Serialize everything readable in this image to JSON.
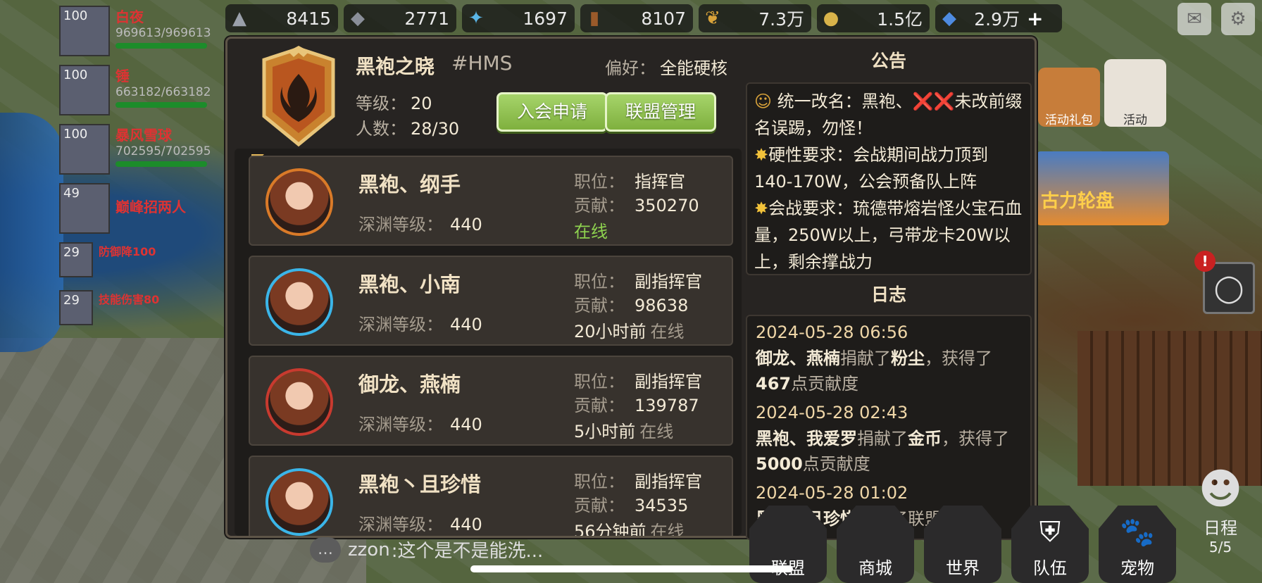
{
  "resources": [
    {
      "icon": "stone-icon",
      "value": "8415"
    },
    {
      "icon": "iron-icon",
      "value": "2771"
    },
    {
      "icon": "crystal-icon",
      "value": "1697"
    },
    {
      "icon": "wood-icon",
      "value": "8107"
    },
    {
      "icon": "wheat-icon",
      "value": "7.3万"
    },
    {
      "icon": "coin-icon",
      "value": "1.5亿"
    },
    {
      "icon": "diamond-icon",
      "value": "2.9万"
    }
  ],
  "party": [
    {
      "level": "100",
      "name": "白夜",
      "hp": "969613/969613"
    },
    {
      "level": "100",
      "name": "锤",
      "hp": "663182/663182"
    },
    {
      "level": "100",
      "name": "暴风雪球",
      "hp": "702595/702595"
    },
    {
      "level": "49",
      "name": "巅峰招两人",
      "hp": ""
    },
    {
      "level": "29",
      "name": "防御降100",
      "hp": ""
    },
    {
      "level": "29",
      "name": "技能伤害80",
      "hp": ""
    }
  ],
  "side": {
    "gift_label": "活动礼包",
    "event_label": "活动",
    "banner_label": "古力轮盘",
    "alert": "!"
  },
  "guild": {
    "name": "黑袍之晓",
    "tag": "#HMS",
    "pref_label": "偏好：",
    "pref_value": "全能硬核",
    "level_label": "等级：",
    "level_value": "20",
    "count_label": "人数：",
    "count_value": "28/30",
    "apply_btn": "入会申请",
    "manage_btn": "联盟管理"
  },
  "members": [
    {
      "name": "黑袍、纲手",
      "abyss_label": "深渊等级：",
      "abyss": "440",
      "pos_label": "职位：",
      "pos": "指挥官",
      "contrib_label": "贡献：",
      "contrib": "350270",
      "status_time": "",
      "status": "在线"
    },
    {
      "name": "黑袍、小南",
      "abyss_label": "深渊等级：",
      "abyss": "440",
      "pos_label": "职位：",
      "pos": "副指挥官",
      "contrib_label": "贡献：",
      "contrib": "98638",
      "status_time": "20小时前",
      "status": "在线"
    },
    {
      "name": "御龙、燕楠",
      "abyss_label": "深渊等级：",
      "abyss": "440",
      "pos_label": "职位：",
      "pos": "副指挥官",
      "contrib_label": "贡献：",
      "contrib": "139787",
      "status_time": "5小时前",
      "status": "在线"
    },
    {
      "name": "黑袍丶且珍惜",
      "abyss_label": "深渊等级：",
      "abyss": "440",
      "pos_label": "职位：",
      "pos": "副指挥官",
      "contrib_label": "贡献：",
      "contrib": "34535",
      "status_time": "56分钟前",
      "status": "在线"
    }
  ],
  "notice": {
    "title": "公告",
    "line1_a": "统一改名：黑袍、",
    "line1_x": "❌❌",
    "line1_b": "未改前缀名误踢，勿怪！",
    "line2": "硬性要求：会战期间战力顶到140-170W，公会预备队上阵",
    "line3": "会战要求：琉德带熔岩怪火宝石血量，250W以上，弓带龙卡20W以上，剩余撑战力"
  },
  "log": {
    "title": "日志",
    "entries": [
      {
        "date": "2024-05-28 06:56",
        "who": "御龙、燕楠",
        "action": "捐献了",
        "item": "粉尘",
        "mid": "，获得了",
        "points": "467",
        "end": "点贡献度"
      },
      {
        "date": "2024-05-28 02:43",
        "who": "黑袍、我爱罗",
        "action": "捐献了",
        "item": "金币",
        "mid": "，获得了",
        "points": "5000",
        "end": "点贡献度"
      },
      {
        "date": "2024-05-28 01:02",
        "who": "黑袍丶且珍惜",
        "action": "开启了联盟加成",
        "item": "",
        "mid": "",
        "points": "",
        "end": ""
      }
    ]
  },
  "chat": {
    "user": "zzon",
    "text": ":这个是不是能洗..."
  },
  "nav": {
    "alliance": "联盟",
    "shop": "商城",
    "world": "世界",
    "team": "队伍",
    "pet": "宠物",
    "schedule": "日程",
    "schedule_count": "5/5"
  }
}
